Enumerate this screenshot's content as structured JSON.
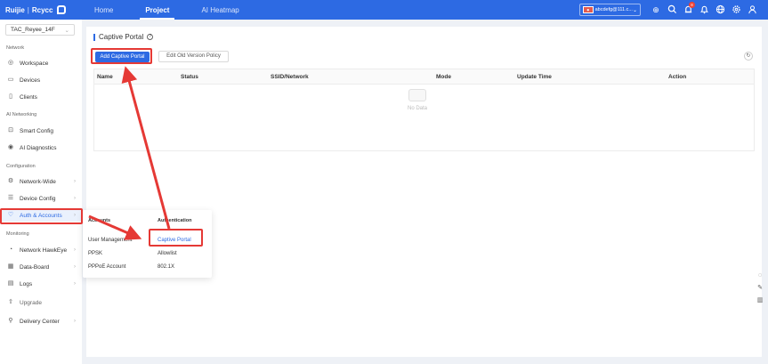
{
  "topbar": {
    "brand": "Ruijie",
    "brand_sub": "Rcycc",
    "nav": [
      "Home",
      "Project",
      "AI Heatmap"
    ],
    "account": "abcdefg@111.c...",
    "notification_count": "8"
  },
  "sidebar": {
    "site": "TAC_Reyee_14F",
    "sections": {
      "network": "Network",
      "ai": "AI Networking",
      "config": "Configuration",
      "monitor": "Monitoring"
    },
    "items": {
      "workspace": "Workspace",
      "devices": "Devices",
      "clients": "Clients",
      "smart": "Smart Config",
      "diag": "AI Diagnostics",
      "netwide": "Network-Wide",
      "devconf": "Device Config",
      "auth": "Auth & Accounts",
      "hawkeye": "Network HawkEye",
      "databoard": "Data-Board",
      "logs": "Logs",
      "upgrade": "Upgrade",
      "delivery": "Delivery Center"
    }
  },
  "main": {
    "title": "Captive Portal",
    "add_button": "Add Captive Portal",
    "edit_button": "Edit Old Version Policy",
    "columns": [
      "Name",
      "Status",
      "SSID/Network",
      "Mode",
      "Update Time",
      "Action"
    ],
    "empty_text": "No Data"
  },
  "flyout": {
    "col1_head": "Accounts",
    "col2_head": "Authentication",
    "col1": [
      "User Management",
      "PPSK",
      "PPPoE Account"
    ],
    "col2": [
      "Captive Portal",
      "Allowlist",
      "802.1X"
    ]
  },
  "colors": {
    "primary": "#2d6ae3",
    "highlight": "#e53935"
  }
}
